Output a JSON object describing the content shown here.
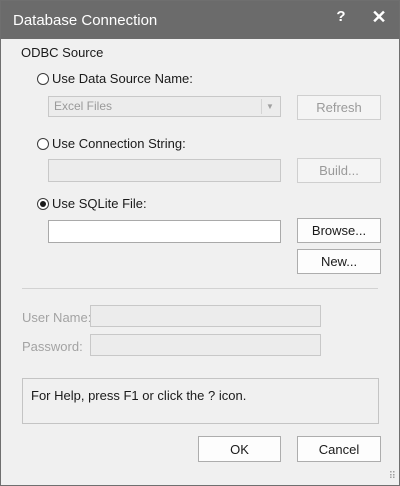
{
  "window": {
    "title": "Database Connection",
    "help_symbol": "?",
    "close_symbol": "✕"
  },
  "odbc": {
    "heading": "ODBC Source",
    "dsn_label": "Use Data Source Name:",
    "dsn_selected": "Excel Files",
    "refresh_label": "Refresh",
    "connstr_label": "Use Connection String:",
    "build_label": "Build...",
    "sqlite_label": "Use SQLite File:",
    "browse_label": "Browse...",
    "new_label": "New..."
  },
  "credentials": {
    "username_label": "User Name:",
    "password_label": "Password:"
  },
  "help_text": "For Help, press F1 or click the ? icon.",
  "footer": {
    "ok_label": "OK",
    "cancel_label": "Cancel"
  },
  "colors": {
    "titlebar": "#6b6b6b",
    "dialog_bg": "#f0f0f0"
  }
}
